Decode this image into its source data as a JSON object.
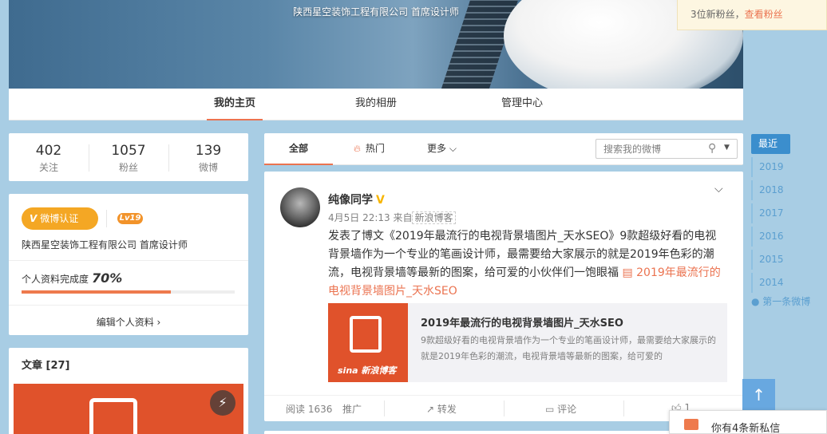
{
  "banner": {
    "title": "陕西星空装饰工程有限公司 首席设计师"
  },
  "fan_notice": {
    "text": "3位新粉丝，",
    "link": "查看粉丝"
  },
  "nav": {
    "tabs": [
      {
        "label": "我的主页",
        "active": true
      },
      {
        "label": "我的相册",
        "active": false
      },
      {
        "label": "管理中心",
        "active": false
      }
    ]
  },
  "stats": [
    {
      "num": "402",
      "label": "关注"
    },
    {
      "num": "1057",
      "label": "粉丝"
    },
    {
      "num": "139",
      "label": "微博"
    }
  ],
  "profile": {
    "verify_badge": "微博认证",
    "verify_v": "V",
    "level": "Lv19",
    "company": "陕西星空装饰工程有限公司 首席设计师",
    "completion_label": "个人资料完成度",
    "completion_value": "70%",
    "completion_fraction": 0.7,
    "edit_label": "编辑个人资料 ›"
  },
  "articles": {
    "title": "文章 [27]"
  },
  "feed_tabs": {
    "all": "全部",
    "hot": "热门",
    "more": "更多 ⌵",
    "search_placeholder": "搜索我的微博"
  },
  "post": {
    "author": "纯像同学",
    "time": "4月5日 22:13 来自",
    "source": "新浪博客",
    "text": "发表了博文《2019年最流行的电视背景墙图片_天水SEO》9款超级好看的电视背景墙作为一个专业的笔画设计师，最需要给大家展示的就是2019年色彩的潮流，电视背景墙等最新的图案，给可爱的小伙伴们一饱眼福",
    "link_text": "2019年最流行的电视背景墙图片_天水SEO",
    "preview_title": "2019年最流行的电视背景墙图片_天水SEO",
    "preview_desc": "9款超级好看的电视背景墙作为一个专业的笔画设计师，最需要给大家展示的就是2019年色彩的潮流，电视背景墙等最新的图案，给可爱的",
    "preview_brand": "sina 新浪博客",
    "reads": "阅读 1636",
    "promote": "推广",
    "forward": "转发",
    "comment": "评论",
    "likes": "1"
  },
  "timeline": {
    "head": "最近",
    "years": [
      "2019",
      "2018",
      "2017",
      "2016",
      "2015",
      "2014"
    ],
    "first": "● 第一条微博"
  },
  "messages": {
    "text": "你有4条新私信"
  },
  "colors": {
    "accent": "#eb7350",
    "link_blue": "#5b9fd0",
    "background": "#a8cde4"
  }
}
